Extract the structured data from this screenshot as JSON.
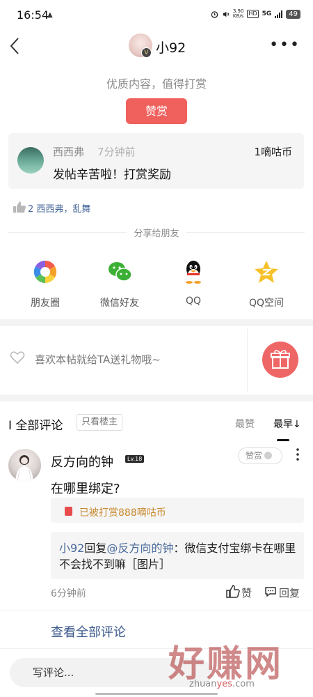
{
  "status_bar": {
    "time": "16:54",
    "net_speed_value": "3.90",
    "net_speed_unit": "KB/s",
    "hd": "HD",
    "network": "5G",
    "battery": "49"
  },
  "header": {
    "author_name": "小92",
    "verified_badge": "V"
  },
  "reward": {
    "tip": "优质内容，值得打赏",
    "button_label": "赞赏"
  },
  "reward_record": {
    "user": "西西弗",
    "time": "7分钟前",
    "amount": "1嘀咕币",
    "message": "发帖辛苦啦！打赏奖励"
  },
  "likes": {
    "text": "2 西西弗，乱舞"
  },
  "share": {
    "title": "分享给朋友",
    "items": [
      {
        "label": "朋友圈",
        "icon": "moments-icon"
      },
      {
        "label": "微信好友",
        "icon": "wechat-icon"
      },
      {
        "label": "QQ",
        "icon": "qq-icon"
      },
      {
        "label": "QQ空间",
        "icon": "qzone-icon"
      }
    ]
  },
  "gift": {
    "text": "喜欢本帖就给TA送礼物哦~"
  },
  "comments": {
    "title": "I 全部评论",
    "only_owner": "只看楼主",
    "sort_hot": "最赞",
    "sort_early": "最早↓",
    "items": [
      {
        "user": "反方向的钟",
        "level": "Lv.18",
        "reward_button": "赞赏",
        "text": "在哪里绑定?",
        "rewarded_text": "已被打赏888嘀咕币",
        "reply_author": "小92",
        "reply_word": "回复",
        "reply_to": "@反方向的钟",
        "reply_text": "：微信支付宝绑卡在哪里不会找不到嘛［图片］",
        "time": "6分钟前",
        "like_label": "赞",
        "reply_label": "回复"
      }
    ],
    "view_all": "查看全部评论"
  },
  "bottom": {
    "input_placeholder": "写评论..."
  },
  "watermark": {
    "main": "好赚网",
    "url_prefix": "zhuan",
    "url_highlight": "yes",
    "url_suffix": ".com"
  },
  "colors": {
    "accent": "#f0605d",
    "link": "#4a6a9c",
    "reward_gold": "#c8892d"
  }
}
